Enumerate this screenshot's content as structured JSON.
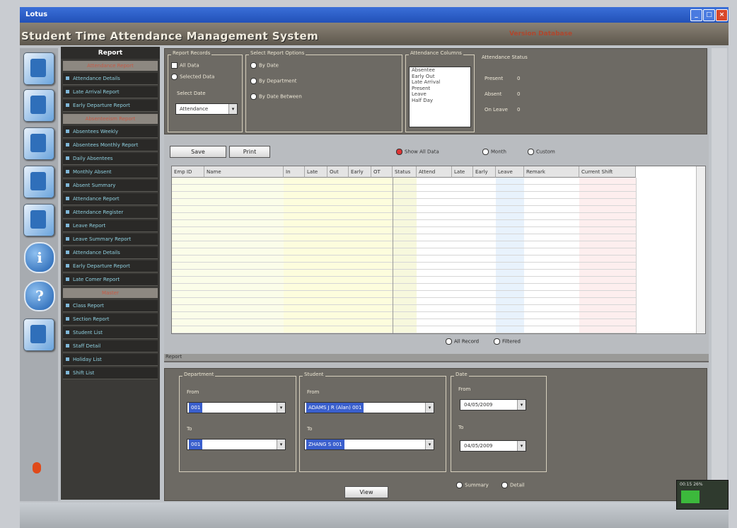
{
  "window": {
    "title": "Lotus",
    "min": "_",
    "max": "□",
    "close": "×"
  },
  "app": {
    "name": "Student Time Attendance Management System",
    "subtitle": "Version Database"
  },
  "sidebar": {
    "heading": "Report",
    "sec1": "Attendance Report",
    "items1": [
      "Attendance Details",
      "Late Arrival Report",
      "Early Departure Report"
    ],
    "sec2": "Absenteeism Report",
    "items2": [
      "Absentees Weekly",
      "Absentees Monthly Report",
      "Daily Absentees",
      "Monthly Absent",
      "Absent Summary",
      "Attendance Report",
      "Attendance Register",
      "Leave Report",
      "Leave Summary Report",
      "Attendance Details",
      "Early Departure Report",
      "Late Comer Report"
    ],
    "sec3": "Master",
    "items3": [
      "Class Report",
      "Section Report",
      "Student List",
      "Staff Detail",
      "Holiday List",
      "Shift List"
    ]
  },
  "filters": {
    "record_caption": "Report Records",
    "rec_all": "All Data",
    "rec_selected": "Selected Data",
    "period_label": "Select Date",
    "period_value": "Attendance",
    "options_caption": "Select Report Options",
    "opt1": "By Date",
    "opt2": "By Department",
    "opt3": "By Date Between",
    "list_caption": "Attendance Columns",
    "list_items": [
      "Absentee",
      "Early Out",
      "Late Arrival",
      "Present",
      "Leave",
      "Half Day"
    ],
    "status_caption": "Attendance Status",
    "status_rows": [
      [
        "Present",
        "0"
      ],
      [
        "Absent",
        "0"
      ],
      [
        "On Leave",
        "0"
      ]
    ]
  },
  "actions": {
    "save": "Save",
    "print": "Print",
    "filter_all": "Show All Data",
    "filter_month": "Month",
    "filter_custom": "Custom"
  },
  "grid": {
    "headers": [
      "Emp ID",
      "Name",
      "In",
      "Late",
      "Out",
      "Early",
      "OT",
      "Status",
      "Attend",
      "Late",
      "Early",
      "Leave",
      "Remark",
      "Current Shift"
    ]
  },
  "grid_options": {
    "opt_a": "All Record",
    "opt_b": "Filtered"
  },
  "bottom": {
    "tabs": "Report",
    "from_caption": "Department",
    "from_label": "From",
    "from_value": "001",
    "to_label": "To",
    "to_value": "001",
    "name_caption": "Student",
    "name_from_label": "From",
    "name_from_value": "ADAMS J R (Alan) 001",
    "name_to_label": "To",
    "name_to_value": "ZHANG S 001",
    "date_caption": "Date",
    "date_from_label": "From",
    "date_from_value": "04/05/2009",
    "date_to_label": "To",
    "date_to_value": "04/05/2009",
    "opt_summary": "Summary",
    "opt_detail": "Detail",
    "view_button": "View"
  },
  "tray": {
    "label": "00:15 26%"
  }
}
